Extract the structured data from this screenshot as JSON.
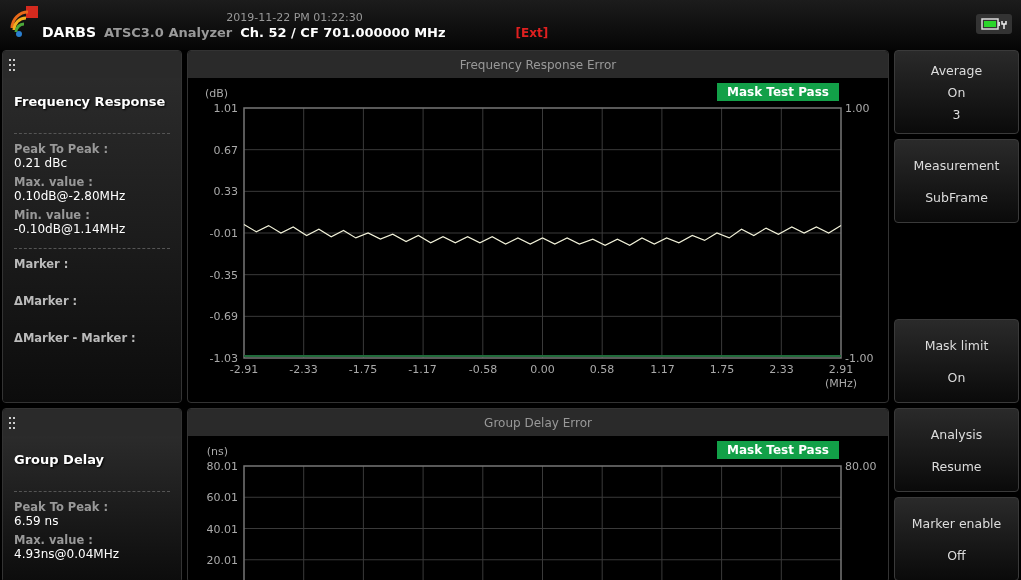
{
  "header": {
    "datetime": "2019-11-22 PM 01:22:30",
    "brand": "DARBS",
    "product": "ATSC3.0 Analyzer",
    "channel": "Ch. 52 / CF 701.000000 MHz",
    "ext": "[Ext]"
  },
  "panels": [
    {
      "title": "Frequency Response",
      "stats": [
        {
          "label": "Peak To Peak :",
          "value": "0.21 dBc"
        },
        {
          "label": "Max. value :",
          "value": "0.10dB@-2.80MHz"
        },
        {
          "label": "Min. value :",
          "value": "-0.10dB@1.14MHz"
        }
      ],
      "markers": [
        "Marker :",
        "ΔMarker :",
        "ΔMarker - Marker :"
      ],
      "chart": {
        "title": "Frequency Response Error",
        "badge": "Mask Test Pass",
        "right_labels": [
          "1.00",
          "-1.00"
        ],
        "chart_data": {
          "type": "line",
          "grid": true,
          "xlabel": "(MHz)",
          "ylabel": "(dB)",
          "xlim": [
            -2.91,
            2.91
          ],
          "ylim": [
            -1.03,
            1.01
          ],
          "xticks": [
            {
              "value": -2.91,
              "label": "-2.91"
            },
            {
              "value": -2.33,
              "label": "-2.33"
            },
            {
              "value": -1.75,
              "label": "-1.75"
            },
            {
              "value": -1.17,
              "label": "-1.17"
            },
            {
              "value": -0.58,
              "label": "-0.58"
            },
            {
              "value": 0,
              "label": "0.00"
            },
            {
              "value": 0.58,
              "label": "0.58"
            },
            {
              "value": 1.17,
              "label": "1.17"
            },
            {
              "value": 1.75,
              "label": "1.75"
            },
            {
              "value": 2.33,
              "label": "2.33"
            },
            {
              "value": 2.91,
              "label": "2.91"
            }
          ],
          "yticks": [
            {
              "value": 1.01,
              "label": "1.01"
            },
            {
              "value": 0.67,
              "label": "0.67"
            },
            {
              "value": 0.33,
              "label": "0.33"
            },
            {
              "value": -0.01,
              "label": "-0.01"
            },
            {
              "value": -0.35,
              "label": "-0.35"
            },
            {
              "value": -0.69,
              "label": "-0.69"
            },
            {
              "value": -1.03,
              "label": "-1.03"
            }
          ],
          "x": [
            -2.91,
            -2.79,
            -2.67,
            -2.55,
            -2.43,
            -2.3,
            -2.18,
            -2.06,
            -1.94,
            -1.82,
            -1.7,
            -1.58,
            -1.46,
            -1.33,
            -1.21,
            -1.09,
            -0.97,
            -0.85,
            -0.73,
            -0.61,
            -0.49,
            -0.36,
            -0.24,
            -0.12,
            0.0,
            0.12,
            0.24,
            0.36,
            0.49,
            0.61,
            0.73,
            0.85,
            0.97,
            1.09,
            1.21,
            1.33,
            1.46,
            1.58,
            1.7,
            1.82,
            1.94,
            2.06,
            2.18,
            2.3,
            2.43,
            2.55,
            2.67,
            2.79,
            2.91
          ],
          "series": [
            {
              "color": "#f0f0d8",
              "values": [
                0.06,
                0.0,
                0.05,
                -0.01,
                0.04,
                -0.03,
                0.02,
                -0.04,
                0.01,
                -0.05,
                -0.01,
                -0.06,
                -0.02,
                -0.08,
                -0.03,
                -0.09,
                -0.04,
                -0.09,
                -0.04,
                -0.09,
                -0.04,
                -0.1,
                -0.05,
                -0.1,
                -0.05,
                -0.1,
                -0.05,
                -0.1,
                -0.06,
                -0.11,
                -0.06,
                -0.11,
                -0.05,
                -0.1,
                -0.05,
                -0.09,
                -0.03,
                -0.07,
                -0.01,
                -0.05,
                0.02,
                -0.03,
                0.03,
                -0.02,
                0.04,
                -0.01,
                0.04,
                -0.01,
                0.05
              ]
            }
          ]
        }
      }
    },
    {
      "title": "Group Delay",
      "stats": [
        {
          "label": "Peak To Peak :",
          "value": "6.59 ns"
        },
        {
          "label": "Max. value  :",
          "value": "4.93ns@0.04MHz"
        }
      ],
      "chart": {
        "title": "Group Delay Error",
        "badge": "Mask Test Pass",
        "right_labels": [
          "80.00"
        ],
        "unit": "(ns)",
        "y_labels": [
          "80.01",
          "60.01",
          "40.01",
          "20.01"
        ]
      }
    }
  ],
  "soft_keys": [
    [
      {
        "lines": [
          "Average",
          "On",
          "3"
        ]
      },
      {
        "lines": [
          "Measurement",
          "SubFrame"
        ]
      },
      {
        "lines": [
          "Mask limit",
          "On"
        ]
      }
    ],
    [
      {
        "lines": [
          "Analysis",
          "Resume"
        ]
      },
      {
        "lines": [
          "Marker enable",
          "Off"
        ]
      }
    ]
  ]
}
